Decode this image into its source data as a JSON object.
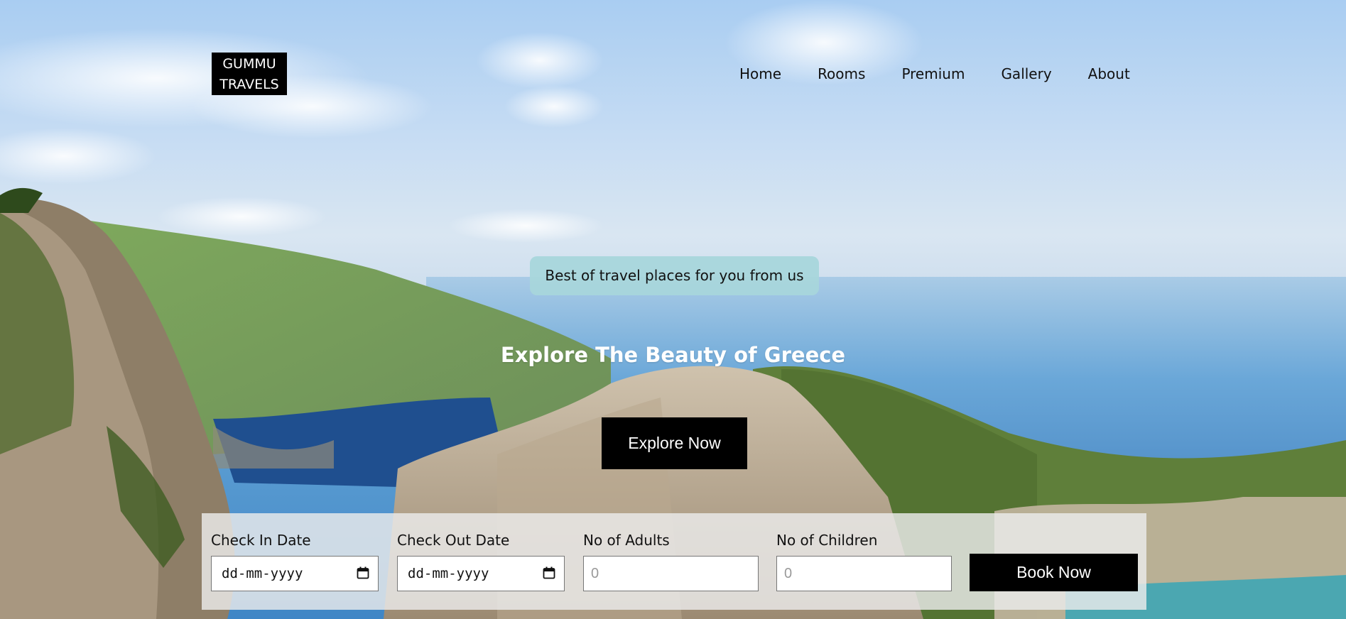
{
  "logo": {
    "line1": "GUMMU",
    "line2": "TRAVELS"
  },
  "nav": {
    "items": [
      {
        "label": "Home"
      },
      {
        "label": "Rooms"
      },
      {
        "label": "Premium"
      },
      {
        "label": "Gallery"
      },
      {
        "label": "About"
      }
    ]
  },
  "hero": {
    "tagline": "Best of travel places for you from us",
    "headline": "Explore The Beauty of Greece",
    "cta_label": "Explore Now"
  },
  "booking": {
    "check_in": {
      "label": "Check In Date",
      "placeholder": "dd-mm-yyyy"
    },
    "check_out": {
      "label": "Check Out Date",
      "placeholder": "dd-mm-yyyy"
    },
    "adults": {
      "label": "No of Adults",
      "placeholder": "0"
    },
    "children": {
      "label": "No of Children",
      "placeholder": "0"
    },
    "submit_label": "Book Now"
  },
  "icons": {
    "date_picker": "calendar-icon"
  },
  "colors": {
    "tagline_bg": "#a8d6db",
    "button_bg": "#000000",
    "button_text": "#ffffff"
  }
}
